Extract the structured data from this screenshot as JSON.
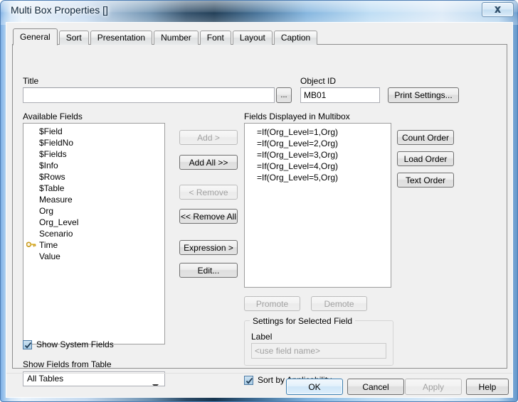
{
  "window": {
    "title": "Multi Box Properties []",
    "close_icon": "close-icon"
  },
  "tabs": [
    {
      "label": "General",
      "active": true
    },
    {
      "label": "Sort",
      "active": false
    },
    {
      "label": "Presentation",
      "active": false
    },
    {
      "label": "Number",
      "active": false
    },
    {
      "label": "Font",
      "active": false
    },
    {
      "label": "Layout",
      "active": false
    },
    {
      "label": "Caption",
      "active": false
    }
  ],
  "general": {
    "title_label": "Title",
    "title_value": "",
    "title_placeholder": "",
    "title_browse_button": "...",
    "object_id_label": "Object ID",
    "object_id_value": "MB01",
    "print_settings_button": "Print Settings...",
    "available_fields_label": "Available Fields",
    "available_fields": [
      {
        "name": "$Field",
        "key": false
      },
      {
        "name": "$FieldNo",
        "key": false
      },
      {
        "name": "$Fields",
        "key": false
      },
      {
        "name": "$Info",
        "key": false
      },
      {
        "name": "$Rows",
        "key": false
      },
      {
        "name": "$Table",
        "key": false
      },
      {
        "name": "Measure",
        "key": false
      },
      {
        "name": "Org",
        "key": false
      },
      {
        "name": "Org_Level",
        "key": false
      },
      {
        "name": "Scenario",
        "key": false
      },
      {
        "name": "Time",
        "key": true
      },
      {
        "name": "Value",
        "key": false
      }
    ],
    "transfer_buttons": [
      {
        "label": "Add >",
        "enabled": false,
        "name": "add-button"
      },
      {
        "label": "Add All >>",
        "enabled": true,
        "name": "add-all-button"
      },
      {
        "label": "< Remove",
        "enabled": false,
        "name": "remove-button"
      },
      {
        "label": "<< Remove All",
        "enabled": true,
        "name": "remove-all-button"
      },
      {
        "label": "Expression >",
        "enabled": true,
        "name": "expression-button"
      },
      {
        "label": "Edit...",
        "enabled": true,
        "name": "edit-button"
      }
    ],
    "displayed_fields_label": "Fields Displayed in Multibox",
    "displayed_fields": [
      "=If(Org_Level=1,Org)",
      "=If(Org_Level=2,Org)",
      "=If(Org_Level=3,Org)",
      "=If(Org_Level=4,Org)",
      "=If(Org_Level=5,Org)"
    ],
    "order_buttons": [
      {
        "label": "Count Order",
        "name": "count-order-button"
      },
      {
        "label": "Load Order",
        "name": "load-order-button"
      },
      {
        "label": "Text Order",
        "name": "text-order-button"
      }
    ],
    "promote_button": "Promote",
    "demote_button": "Demote",
    "settings_group_title": "Settings for Selected Field",
    "label_label": "Label",
    "label_value": "",
    "label_placeholder": "<use field name>",
    "show_system_fields": {
      "label": "Show System Fields",
      "checked": true
    },
    "show_fields_from_table_label": "Show Fields from Table",
    "show_fields_from_table_value": "All Tables",
    "sort_by_applicability": {
      "label": "Sort by Applicability",
      "checked": true
    }
  },
  "footer": {
    "ok": "OK",
    "cancel": "Cancel",
    "apply": "Apply",
    "help": "Help"
  },
  "colors": {
    "accent": "#3c7fb1",
    "window_frame": "#4f7fb5",
    "dialog_bg": "#f0f0f0",
    "key_icon": "#e0b93c"
  }
}
